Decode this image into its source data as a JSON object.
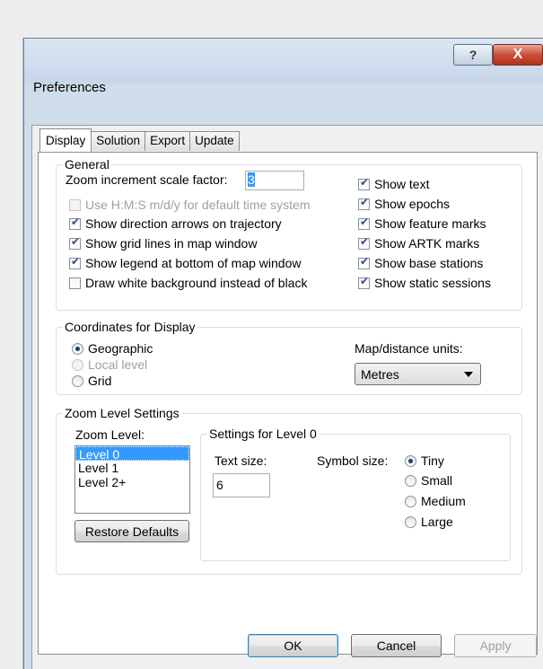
{
  "window": {
    "title": "Preferences",
    "help_label": "?",
    "close_label": "X"
  },
  "tabs": [
    {
      "label": "Display",
      "active": true
    },
    {
      "label": "Solution",
      "active": false
    },
    {
      "label": "Export",
      "active": false
    },
    {
      "label": "Update",
      "active": false
    }
  ],
  "general": {
    "label": "General",
    "zoom_factor_label": "Zoom increment scale factor:",
    "zoom_factor_value": "3",
    "left_options": [
      {
        "label": "Use H:M:S m/d/y for default time system",
        "checked": false,
        "disabled": true
      },
      {
        "label": "Show direction arrows on trajectory",
        "checked": true,
        "disabled": false
      },
      {
        "label": "Show grid lines in map window",
        "checked": true,
        "disabled": false
      },
      {
        "label": "Show legend at bottom of map window",
        "checked": true,
        "disabled": false
      },
      {
        "label": "Draw white background instead of black",
        "checked": false,
        "disabled": false
      }
    ],
    "right_options": [
      {
        "label": "Show text",
        "checked": true
      },
      {
        "label": "Show epochs",
        "checked": true
      },
      {
        "label": "Show feature marks",
        "checked": true
      },
      {
        "label": "Show ARTK marks",
        "checked": true
      },
      {
        "label": "Show base stations",
        "checked": true
      },
      {
        "label": "Show static sessions",
        "checked": true
      }
    ]
  },
  "coordinates": {
    "label": "Coordinates for Display",
    "options": [
      {
        "label": "Geographic",
        "checked": true,
        "disabled": false
      },
      {
        "label": "Local level",
        "checked": false,
        "disabled": true
      },
      {
        "label": "Grid",
        "checked": false,
        "disabled": false
      }
    ],
    "units_label": "Map/distance units:",
    "units_value": "Metres"
  },
  "zoom": {
    "label": "Zoom Level Settings",
    "level_label": "Zoom Level:",
    "levels": [
      "Level 0",
      "Level 1",
      "Level 2+"
    ],
    "selected_level": "Level 0",
    "restore_label": "Restore Defaults",
    "settings_label": "Settings for Level 0",
    "text_size_label": "Text size:",
    "text_size_value": "6",
    "symbol_size_label": "Symbol size:",
    "symbol_sizes": [
      {
        "label": "Tiny",
        "checked": true
      },
      {
        "label": "Small",
        "checked": false
      },
      {
        "label": "Medium",
        "checked": false
      },
      {
        "label": "Large",
        "checked": false
      }
    ]
  },
  "buttons": {
    "ok": "OK",
    "cancel": "Cancel",
    "apply": "Apply"
  }
}
